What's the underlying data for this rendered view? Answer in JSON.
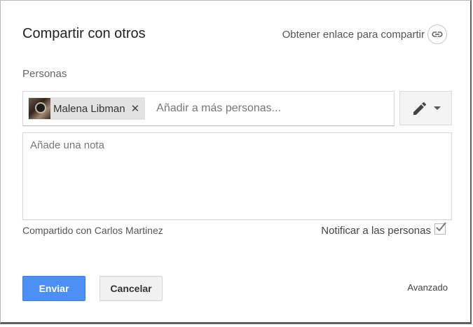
{
  "dialog": {
    "title": "Compartir con otros",
    "get_link_label": "Obtener enlace para compartir",
    "get_link_icon": "link-icon"
  },
  "people": {
    "section_label": "Personas",
    "chips": [
      {
        "name": "Malena Libman",
        "remove_icon": "close-icon"
      }
    ],
    "add_placeholder": "Añadir a más personas...",
    "permission_icon": "pencil-icon"
  },
  "note": {
    "placeholder": "Añade una nota"
  },
  "footer_info": {
    "shared_with": "Compartido con Carlos Martinez",
    "notify_label": "Notificar a las personas",
    "notify_checked": true
  },
  "actions": {
    "send_label": "Enviar",
    "cancel_label": "Cancelar",
    "advanced_label": "Avanzado"
  },
  "colors": {
    "primary": "#4d8ff5",
    "text": "#222222"
  }
}
